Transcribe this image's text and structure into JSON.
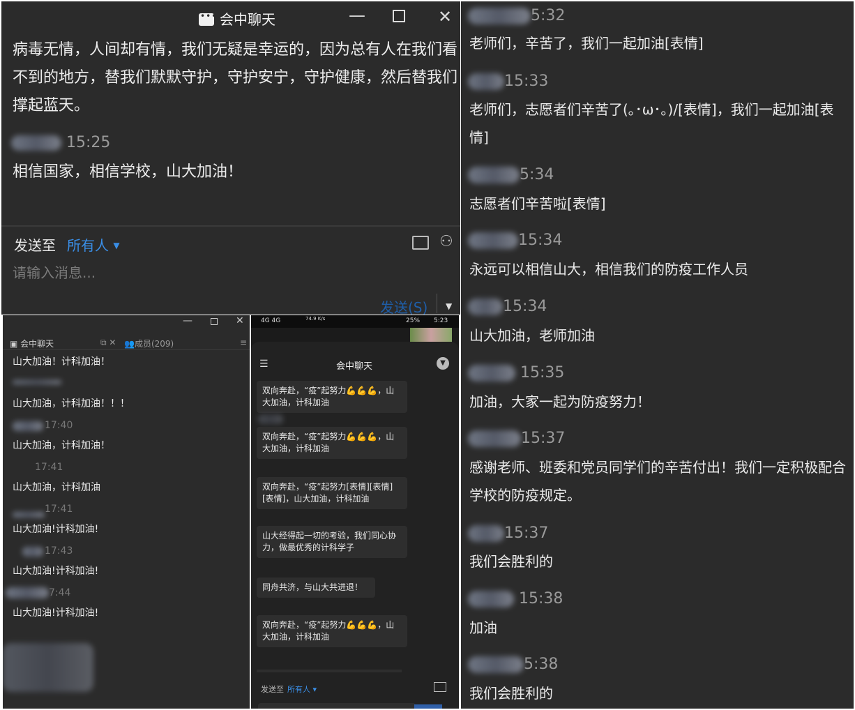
{
  "panel_a": {
    "title": "会中聊天",
    "messages": [
      {
        "text": "病毒无情，人间却有情，我们无疑是幸运的，因为总有人在我们看不到的地方，替我们默默守护，守护安宁，守护健康，然后替我们撑起蓝天。"
      },
      {
        "time": "15:25",
        "text": "相信国家，相信学校，山大加油！"
      }
    ],
    "send_to_label": "发送至",
    "recipient": "所有人",
    "input_placeholder": "请输入消息...",
    "send_button": "发送(S)"
  },
  "panel_b": {
    "title": "会中聊天",
    "members_tab": "成员(209)",
    "messages": [
      {
        "time": "",
        "text": "山大加油！计科加油！"
      },
      {
        "time": "",
        "text": "山大加油，计科加油！！！"
      },
      {
        "time": "17:40",
        "text": "山大加油，计科加油！"
      },
      {
        "time": "17:41",
        "text": "山大加油，计科加油"
      },
      {
        "time": "17:41",
        "text": "山大加油!计科加油!"
      },
      {
        "time": "17:43",
        "text": "山大加油!计科加油!"
      },
      {
        "time": "7:44",
        "text": "山大加油!计科加油!"
      }
    ]
  },
  "panel_c": {
    "status_left": "4G 4G",
    "status_speed": "74.9 K/s",
    "status_battery": "25%",
    "status_time": "5:23",
    "header": "会中聊天",
    "bubbles": [
      {
        "text": "双向奔赴，“疫”起努力💪💪💪，山大加油，计科加油"
      },
      {
        "text": "双向奔赴，“疫”起努力💪💪💪，山大加油，计科加油"
      },
      {
        "text": "双向奔赴，“疫”起努力[表情][表情][表情]，山大加油，计科加油"
      },
      {
        "text": "山大经得起一切的考验，我们同心协力，做最优秀的计科学子"
      },
      {
        "text": "同舟共济，与山大共进退！"
      },
      {
        "text": "双向奔赴，“疫”起努力💪💪💪，山大加油，计科加油"
      }
    ],
    "send_to_label": "发送至",
    "recipient": "所有人"
  },
  "panel_d": {
    "messages": [
      {
        "time": "5:32",
        "text": "老师们，辛苦了，我们一起加油[表情]"
      },
      {
        "time": "15:33",
        "text": "老师们，志愿者们辛苦了(｡･ω･｡)/[表情]，我们一起加油[表情]"
      },
      {
        "time": "5:34",
        "text": "志愿者们辛苦啦[表情]"
      },
      {
        "time": "15:34",
        "text": "永远可以相信山大，相信我们的防疫工作人员"
      },
      {
        "time": "15:34",
        "text": "山大加油，老师加油"
      },
      {
        "time": "15:35",
        "text": "加油，大家一起为防疫努力！"
      },
      {
        "time": "15:37",
        "text": "感谢老师、班委和党员同学们的辛苦付出！我们一定积极配合学校的防疫规定。"
      },
      {
        "time": "15:37",
        "text": "我们会胜利的"
      },
      {
        "time": "15:38",
        "text": "加油"
      },
      {
        "time": "5:38",
        "text": "我们会胜利的"
      }
    ]
  },
  "colors": {
    "background": "#2b2b2b",
    "accent": "#3a8ee6",
    "text": "#e6e6e6"
  }
}
